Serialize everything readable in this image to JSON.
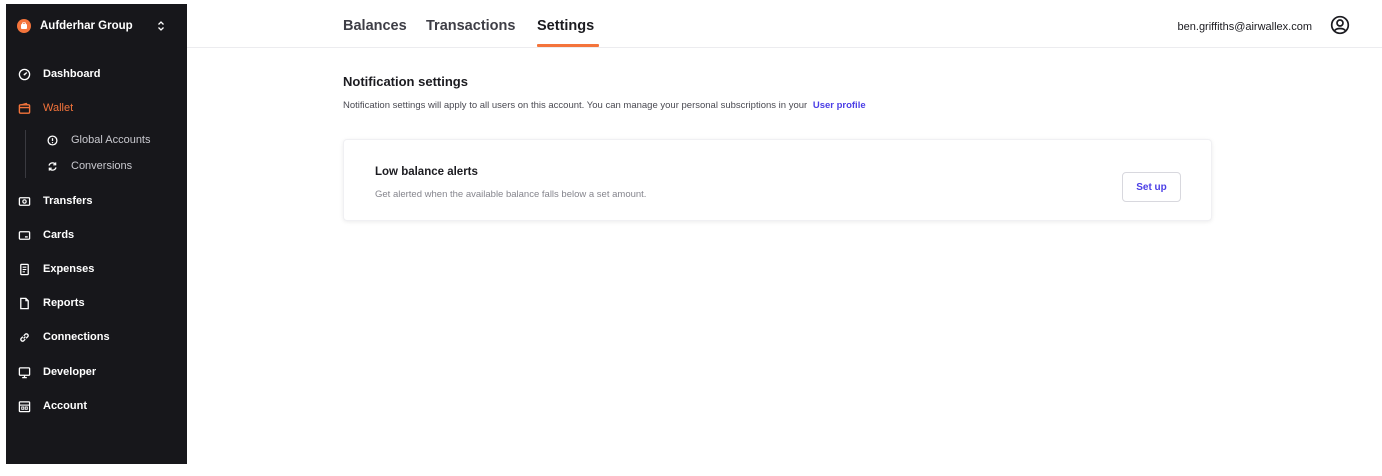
{
  "org": {
    "name": "Aufderhar Group"
  },
  "sidebar": {
    "items": [
      {
        "label": "Dashboard",
        "icon": "dashboard-icon"
      },
      {
        "label": "Wallet",
        "icon": "wallet-icon",
        "active": true
      },
      {
        "label": "Transfers",
        "icon": "transfers-icon"
      },
      {
        "label": "Cards",
        "icon": "cards-icon"
      },
      {
        "label": "Expenses",
        "icon": "expenses-icon"
      },
      {
        "label": "Reports",
        "icon": "reports-icon"
      },
      {
        "label": "Connections",
        "icon": "connections-icon"
      },
      {
        "label": "Developer",
        "icon": "developer-icon"
      },
      {
        "label": "Account",
        "icon": "account-icon"
      }
    ],
    "wallet_sub": [
      {
        "label": "Global Accounts",
        "icon": "global-accounts-icon"
      },
      {
        "label": "Conversions",
        "icon": "conversions-icon"
      }
    ]
  },
  "header": {
    "tabs": [
      {
        "label": "Balances"
      },
      {
        "label": "Transactions"
      },
      {
        "label": "Settings",
        "active": true
      }
    ],
    "user_email": "ben.griffiths@airwallex.com",
    "user_icon": "user-avatar-icon"
  },
  "main": {
    "title": "Notification settings",
    "description": "Notification settings will apply to all users on this account. You can manage your personal subscriptions in your",
    "description_link": "User profile",
    "card": {
      "title": "Low balance alerts",
      "description": "Get alerted when the available balance falls below a set amount.",
      "button_label": "Set up"
    }
  },
  "colors": {
    "sidebar_bg": "#17171b",
    "accent": "#f4743b",
    "link": "#4b3ee6"
  }
}
